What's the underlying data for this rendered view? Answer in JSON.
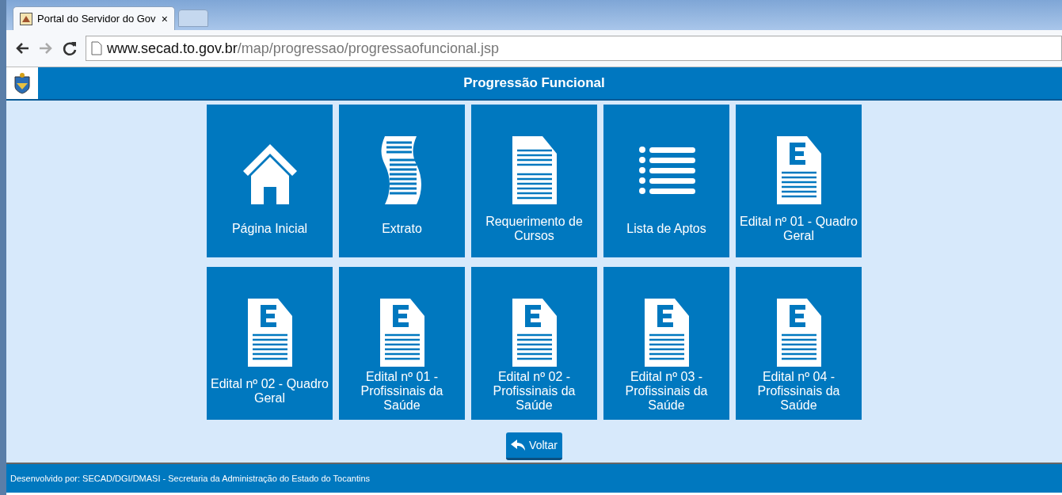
{
  "browser": {
    "tab_title": "Portal do Servidor do Gov",
    "tab_close": "×",
    "url_host": "www.secad.to.gov.br",
    "url_path": "/map/progressao/progressaofuncional.jsp"
  },
  "header": {
    "title": "Progressão Funcional"
  },
  "tiles": [
    {
      "label": "Página Inicial",
      "kind": "home"
    },
    {
      "label": "Extrato",
      "kind": "scroll"
    },
    {
      "label": "Requerimento de Cursos",
      "kind": "document"
    },
    {
      "label": "Lista de Aptos",
      "kind": "list"
    },
    {
      "label": "Edital nº 01 - Quadro Geral",
      "kind": "edital"
    },
    {
      "label": "Edital nº 02 - Quadro Geral",
      "kind": "edital"
    },
    {
      "label": "Edital nº 01 - Profissinais da Saúde",
      "kind": "edital"
    },
    {
      "label": "Edital nº 02 - Profissinais da Saúde",
      "kind": "edital"
    },
    {
      "label": "Edital nº 03 - Profissinais da Saúde",
      "kind": "edital"
    },
    {
      "label": "Edital nº 04 - Profissinais da Saúde",
      "kind": "edital"
    }
  ],
  "back_button": "Voltar",
  "footer": "Desenvolvido por: SECAD/DGI/DMASI - Secretaria da Administração do Estado do Tocantins"
}
